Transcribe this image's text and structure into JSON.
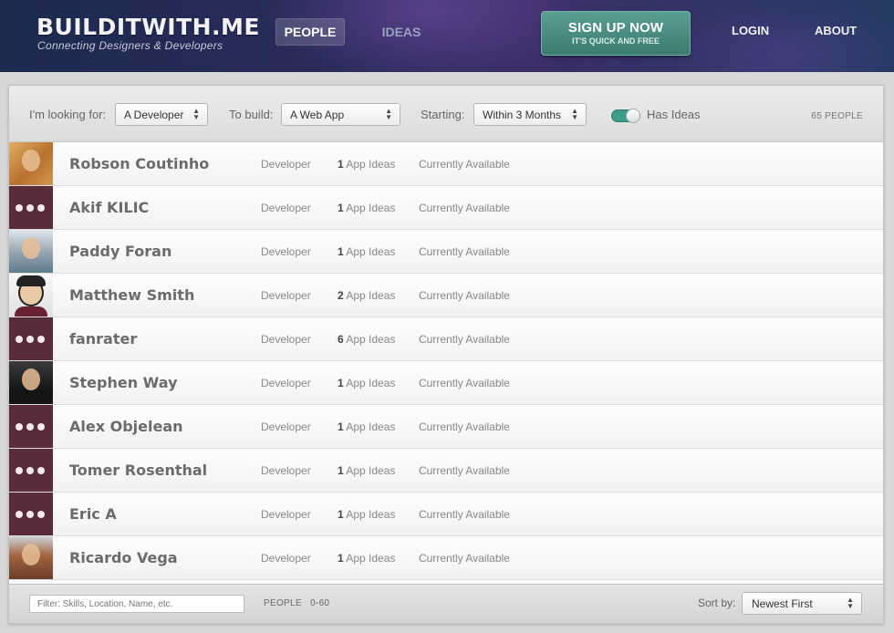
{
  "header": {
    "logo": "BUILDITWITH.ME",
    "tagline": "Connecting Designers & Developers",
    "nav": {
      "people": "PEOPLE",
      "ideas": "IDEAS",
      "login": "LOGIN",
      "about": "ABOUT"
    },
    "signup": {
      "title": "SIGN UP NOW",
      "subtitle": "IT'S QUICK AND FREE"
    }
  },
  "filters": {
    "looking_for_label": "I'm looking for:",
    "looking_for_value": "A Developer",
    "build_label": "To build:",
    "build_value": "A Web App",
    "starting_label": "Starting:",
    "starting_value": "Within 3 Months",
    "has_ideas_label": "Has Ideas",
    "has_ideas_on": true,
    "count": "65 PEOPLE"
  },
  "people": [
    {
      "name": "Robson Coutinho",
      "role": "Developer",
      "ideas_count": "1",
      "ideas_label": "App Ideas",
      "status": "Currently Available",
      "avatar": "photo"
    },
    {
      "name": "Akif KILIC",
      "role": "Developer",
      "ideas_count": "1",
      "ideas_label": "App Ideas",
      "status": "Currently Available",
      "avatar": "placeholder"
    },
    {
      "name": "Paddy Foran",
      "role": "Developer",
      "ideas_count": "1",
      "ideas_label": "App Ideas",
      "status": "Currently Available",
      "avatar": "photo"
    },
    {
      "name": "Matthew Smith",
      "role": "Developer",
      "ideas_count": "2",
      "ideas_label": "App Ideas",
      "status": "Currently Available",
      "avatar": "cartoon"
    },
    {
      "name": "fanrater",
      "role": "Developer",
      "ideas_count": "6",
      "ideas_label": "App Ideas",
      "status": "Currently Available",
      "avatar": "placeholder"
    },
    {
      "name": "Stephen Way",
      "role": "Developer",
      "ideas_count": "1",
      "ideas_label": "App Ideas",
      "status": "Currently Available",
      "avatar": "photo"
    },
    {
      "name": "Alex Objelean",
      "role": "Developer",
      "ideas_count": "1",
      "ideas_label": "App Ideas",
      "status": "Currently Available",
      "avatar": "placeholder"
    },
    {
      "name": "Tomer Rosenthal",
      "role": "Developer",
      "ideas_count": "1",
      "ideas_label": "App Ideas",
      "status": "Currently Available",
      "avatar": "placeholder"
    },
    {
      "name": "Eric A",
      "role": "Developer",
      "ideas_count": "1",
      "ideas_label": "App Ideas",
      "status": "Currently Available",
      "avatar": "placeholder"
    },
    {
      "name": "Ricardo Vega",
      "role": "Developer",
      "ideas_count": "1",
      "ideas_label": "App Ideas",
      "status": "Currently Available",
      "avatar": "photo"
    }
  ],
  "footer": {
    "filter_placeholder": "Filter: Skills, Location, Name, etc.",
    "range_label": "PEOPLE",
    "range_value": "0-60",
    "sort_label": "Sort by:",
    "sort_value": "Newest First"
  },
  "colors": {
    "accent": "#3a9e8a",
    "placeholder_avatar": "#5a2b3b",
    "header_bg": "#2b2b5c"
  }
}
